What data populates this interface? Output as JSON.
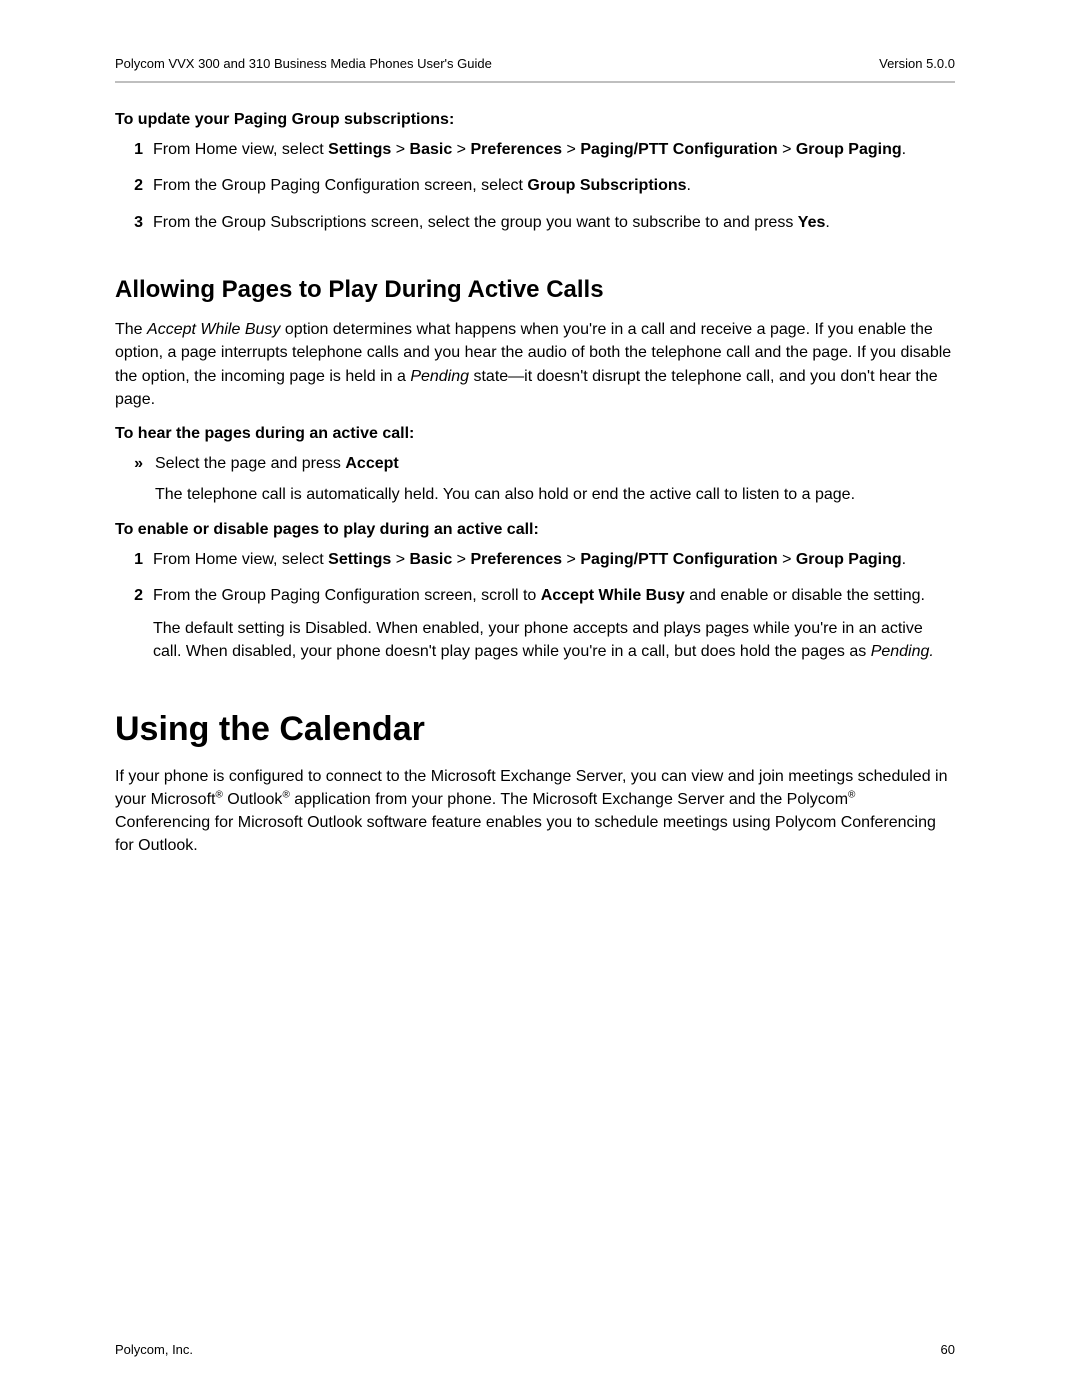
{
  "header": {
    "doc_title": "Polycom VVX 300 and 310 Business Media Phones User's Guide",
    "version": "Version 5.0.0"
  },
  "proc1": {
    "title": "To update your Paging Group subscriptions:",
    "s1_n": "1",
    "s1_a": "From Home view, select ",
    "s1_b": "Settings",
    "s1_c": " > ",
    "s1_d": "Basic",
    "s1_e": " > ",
    "s1_f": "Preferences",
    "s1_g": " > ",
    "s1_h": "Paging/PTT Configuration",
    "s1_i": " > ",
    "s1_j": "Group Paging",
    "s1_k": ".",
    "s2_n": "2",
    "s2_a": "From the Group Paging Configuration screen, select ",
    "s2_b": "Group Subscriptions",
    "s2_c": ".",
    "s3_n": "3",
    "s3_a": "From the Group Subscriptions screen, select the group you want to subscribe to and press ",
    "s3_b": "Yes",
    "s3_c": "."
  },
  "sec1": {
    "heading": "Allowing Pages to Play During Active Calls",
    "p_a": "The ",
    "p_b": "Accept While Busy",
    "p_c": " option determines what happens when you're in a call and receive a page. If you enable the option, a page interrupts telephone calls and you hear the audio of both the telephone call and the page. If you disable the option, the incoming page is held in a ",
    "p_d": "Pending",
    "p_e": " state—it doesn't disrupt the telephone call, and you don't hear the page."
  },
  "proc2": {
    "title": "To hear the pages during an active call:",
    "marker": "»",
    "b_a": "Select the page and press ",
    "b_b": "Accept",
    "cont": "The telephone call is automatically held. You can also hold or end the active call to listen to a page."
  },
  "proc3": {
    "title": "To enable or disable pages to play during an active call:",
    "s1_n": "1",
    "s1_a": "From Home view, select ",
    "s1_b": "Settings",
    "s1_c": " > ",
    "s1_d": "Basic",
    "s1_e": " > ",
    "s1_f": "Preferences",
    "s1_g": " > ",
    "s1_h": "Paging/PTT Configuration",
    "s1_i": " > ",
    "s1_j": "Group Paging",
    "s1_k": ".",
    "s2_n": "2",
    "s2_a": "From the Group Paging Configuration screen, scroll to ",
    "s2_b": "Accept While Busy",
    "s2_c": " and enable or disable the setting.",
    "s2_cont_a": "The default setting is Disabled. When enabled, your phone accepts and plays pages while you're in an active call. When disabled, your phone doesn't play pages while you're in a call, but does hold the pages as ",
    "s2_cont_b": "Pending."
  },
  "sec2": {
    "heading": "Using the Calendar",
    "p_a": "If your phone is configured to connect to the Microsoft Exchange Server, you can view and join meetings scheduled in your Microsoft",
    "reg1": "®",
    "p_b": " Outlook",
    "reg2": "®",
    "p_c": " application from your phone. The Microsoft Exchange Server and the Polycom",
    "reg3": "®",
    "p_d": " Conferencing for Microsoft Outlook software feature enables you to schedule meetings using Polycom Conferencing for Outlook."
  },
  "footer": {
    "company": "Polycom, Inc.",
    "page": "60"
  }
}
